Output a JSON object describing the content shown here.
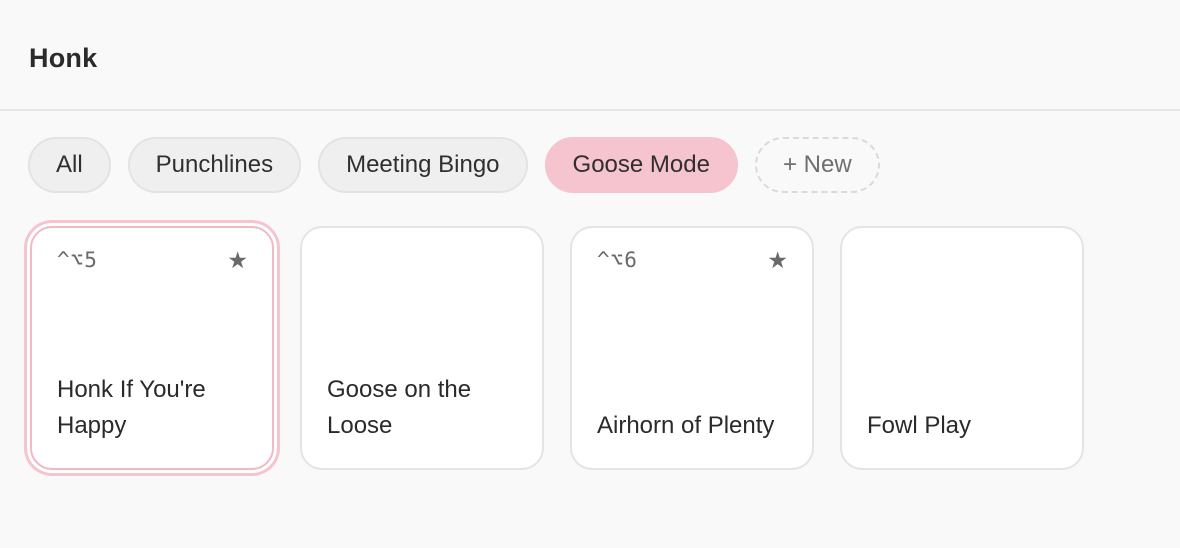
{
  "header": {
    "title": "Honk"
  },
  "filters": [
    {
      "label": "All",
      "active": false
    },
    {
      "label": "Punchlines",
      "active": false
    },
    {
      "label": "Meeting Bingo",
      "active": false
    },
    {
      "label": "Goose Mode",
      "active": true
    }
  ],
  "new_filter_label": "+ New",
  "cards": [
    {
      "shortcut": "^⌥5",
      "favorite_icon": "★",
      "label": "Honk If You're Happy",
      "selected": true
    },
    {
      "shortcut": "",
      "favorite_icon": "",
      "label": "Goose on the Loose",
      "selected": false
    },
    {
      "shortcut": "^⌥6",
      "favorite_icon": "★",
      "label": "Airhorn of Plenty",
      "selected": false
    },
    {
      "shortcut": "",
      "favorite_icon": "",
      "label": "Fowl Play",
      "selected": false
    }
  ],
  "colors": {
    "accent": "#f5c4ce",
    "background": "#f9f9f9",
    "card": "#ffffff"
  }
}
